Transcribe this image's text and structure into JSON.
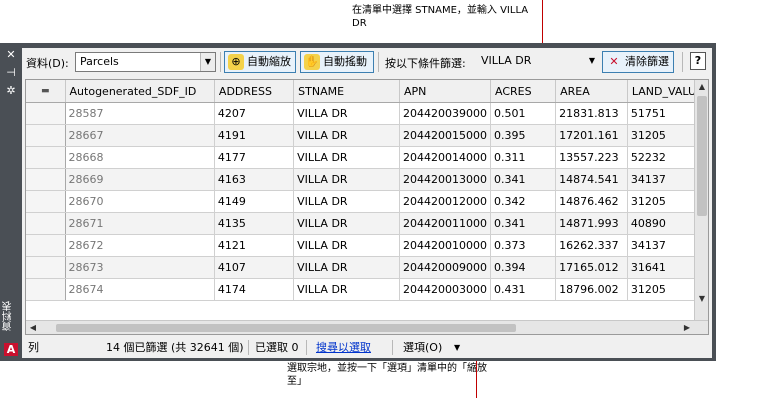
{
  "callouts": {
    "top": "在清單中選擇 STNAME，並輸入 VILLA DR",
    "bottom": "選取宗地，並按一下「選項」清單中的「縮放至」"
  },
  "palette": {
    "title": "資料表",
    "logo": "A"
  },
  "toolbar": {
    "data_label": "資料(D):",
    "data_value": "Parcels",
    "auto_zoom": "自動縮放",
    "auto_pan": "自動搖動",
    "filter_label": "按以下條件篩選:",
    "filter_value": "VILLA DR",
    "clear_filter": "清除篩選",
    "help": "?"
  },
  "table": {
    "columns": [
      "Autogenerated_SDF_ID",
      "ADDRESS",
      "STNAME",
      "APN",
      "ACRES",
      "AREA",
      "LAND_VALUE"
    ],
    "rows": [
      [
        "28587",
        "4207",
        "VILLA DR",
        "204420039000",
        "0.501",
        "21831.813",
        "51751"
      ],
      [
        "28667",
        "4191",
        "VILLA DR",
        "204420015000",
        "0.395",
        "17201.161",
        "31205"
      ],
      [
        "28668",
        "4177",
        "VILLA DR",
        "204420014000",
        "0.311",
        "13557.223",
        "52232"
      ],
      [
        "28669",
        "4163",
        "VILLA DR",
        "204420013000",
        "0.341",
        "14874.541",
        "34137"
      ],
      [
        "28670",
        "4149",
        "VILLA DR",
        "204420012000",
        "0.342",
        "14876.462",
        "31205"
      ],
      [
        "28671",
        "4135",
        "VILLA DR",
        "204420011000",
        "0.341",
        "14871.993",
        "40890"
      ],
      [
        "28672",
        "4121",
        "VILLA DR",
        "204420010000",
        "0.373",
        "16262.337",
        "34137"
      ],
      [
        "28673",
        "4107",
        "VILLA DR",
        "204420009000",
        "0.394",
        "17165.012",
        "31641"
      ],
      [
        "28674",
        "4174",
        "VILLA DR",
        "204420003000",
        "0.431",
        "18796.002",
        "31205"
      ]
    ]
  },
  "status": {
    "rows_label": "列",
    "filtered": "14 個已篩選 (共 32641 個)",
    "selected": "已選取 0",
    "search_selection": "搜尋以選取",
    "options": "選項(O)"
  }
}
